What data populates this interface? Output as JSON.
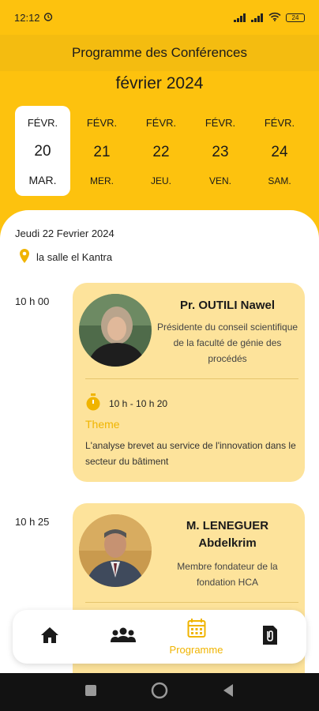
{
  "status_bar": {
    "time": "12:12",
    "battery": "24"
  },
  "app_bar": {
    "title": "Programme des Conférences"
  },
  "month_label": "février 2024",
  "dates": [
    {
      "month": "FÉVR.",
      "day": "20",
      "weekday": "MAR."
    },
    {
      "month": "FÉVR.",
      "day": "21",
      "weekday": "MER."
    },
    {
      "month": "FÉVR.",
      "day": "22",
      "weekday": "JEU."
    },
    {
      "month": "FÉVR.",
      "day": "23",
      "weekday": "VEN."
    },
    {
      "month": "FÉVR.",
      "day": "24",
      "weekday": "SAM."
    }
  ],
  "selected_date_index": 0,
  "day_title": "Jeudi 22 Fevrier 2024",
  "location": "la salle el Kantra",
  "sessions": [
    {
      "start": "10 h 00",
      "speaker": "Pr. OUTILI Nawel",
      "role": "Présidente du conseil scientifique de la faculté de génie des procédés",
      "slot": "10 h - 10 h 20",
      "theme_label": "Theme",
      "theme": "L'analyse brevet au service de l'innovation dans le secteur du bâtiment"
    },
    {
      "start": "10 h 25",
      "speaker_line1": "M. LENEGUER",
      "speaker_line2": "Abdelkrim",
      "role": "Membre fondateur de la fondation HCA"
    }
  ],
  "bottom_nav": {
    "items": [
      {
        "icon": "home-icon"
      },
      {
        "icon": "people-icon"
      },
      {
        "icon": "calendar-icon",
        "label": "Programme"
      },
      {
        "icon": "document-icon"
      }
    ],
    "active_color": "#F0B400"
  },
  "colors": {
    "primary": "#FDC20E",
    "card": "#FDE39B",
    "accent": "#F0B400"
  }
}
